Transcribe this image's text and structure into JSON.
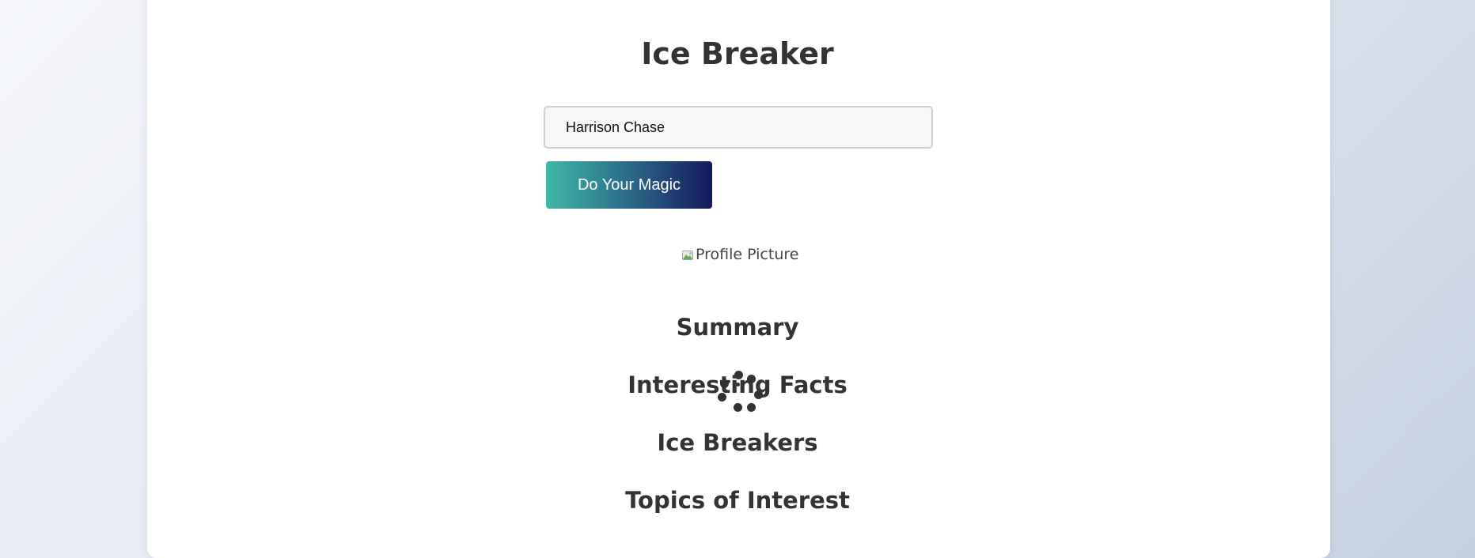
{
  "app": {
    "title": "Ice Breaker"
  },
  "form": {
    "name_value": "Harrison Chase",
    "submit_label": "Do Your Magic"
  },
  "profile": {
    "image_alt": "Profile Picture",
    "broken_image_icon": "broken-image-icon"
  },
  "sections": {
    "summary": "Summary",
    "interesting_facts": "Interesting Facts",
    "ice_breakers": "Ice Breakers",
    "topics_of_interest": "Topics of Interest"
  },
  "loading": {
    "icon": "loading-spinner-icon"
  },
  "colors": {
    "button_gradient_start": "#40b8a8",
    "button_gradient_end": "#141a5c",
    "heading_text": "#333333",
    "card_background": "#ffffff"
  }
}
